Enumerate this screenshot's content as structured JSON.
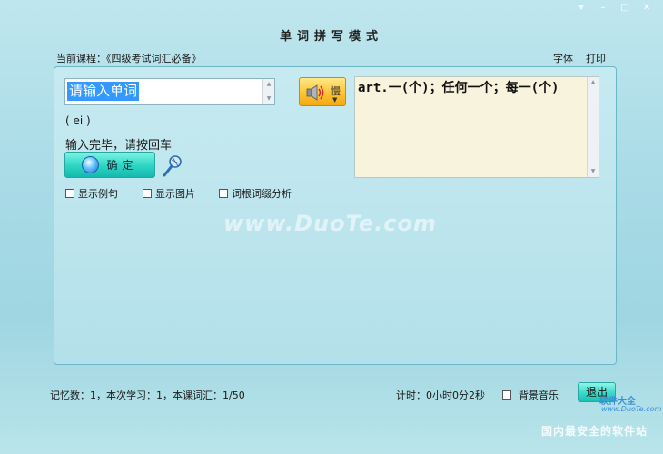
{
  "window": {
    "title": "单词拼写模式",
    "controls": [
      "▾",
      "–",
      "□",
      "✕"
    ]
  },
  "course": {
    "label": "当前课程：",
    "name": "《四级考试词汇必备》"
  },
  "top_links": {
    "font": "字体",
    "print": "打印"
  },
  "input": {
    "value": "请输入单词"
  },
  "speaker": {
    "slow_label": "慢",
    "icon": "speaker-icon"
  },
  "definition": {
    "text": "art.一(个)；任何一个；每一(个)"
  },
  "phonetic": "( ei )",
  "hint": "输入完毕，请按回车",
  "confirm_button": {
    "label": "确定"
  },
  "options": [
    {
      "label": "显示例句",
      "checked": false
    },
    {
      "label": "显示图片",
      "checked": false
    },
    {
      "label": "词根词缀分析",
      "checked": false
    }
  ],
  "watermark": "www.DuoTe.com",
  "status": {
    "memory": "记忆数：1，本次学习：1，本课词汇：1/50",
    "timer": "计时：0小时0分2秒",
    "music_label": "背景音乐",
    "music_checked": false,
    "exit_label": "退出"
  },
  "branding": {
    "name": "软件大全",
    "url": "www.DuoTe.com",
    "tagline": "国内最安全的软件站"
  },
  "colors": {
    "accent_yellow": "#ffc433",
    "accent_teal": "#2fd8c6",
    "selection": "#3399ff"
  }
}
